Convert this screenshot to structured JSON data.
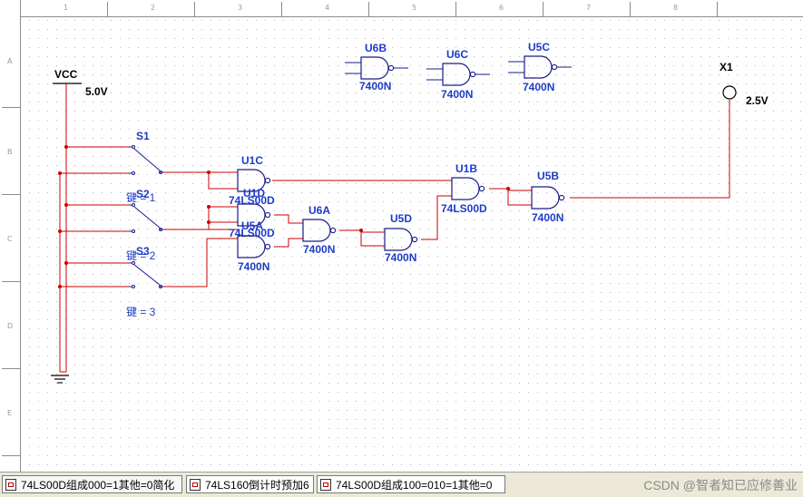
{
  "colors": {
    "wire": "#cc0000",
    "symbol": "#1a1a8c",
    "label": "#1e3cc8",
    "text": "#000000",
    "grid": "#b4b4b4"
  },
  "ruler": {
    "top": [
      "1",
      "2",
      "3",
      "4",
      "5",
      "6",
      "7",
      "8"
    ],
    "left": [
      "A",
      "B",
      "C",
      "D",
      "E"
    ]
  },
  "schematic": {
    "vcc": {
      "name": "VCC",
      "voltage": "5.0V"
    },
    "probe": {
      "name": "X1",
      "reading": "2.5V"
    },
    "switches": [
      {
        "name": "S1",
        "key_label": ""
      },
      {
        "name": "S2",
        "key_label": "键 = 1"
      },
      {
        "name": "S3",
        "key_label": "键 = 2"
      },
      {
        "name": "",
        "key_label": "键 = 3"
      }
    ],
    "gates": {
      "u6b": {
        "ref": "U6B",
        "type": "7400N"
      },
      "u6c": {
        "ref": "U6C",
        "type": "7400N"
      },
      "u5c": {
        "ref": "U5C",
        "type": "7400N"
      },
      "u1c": {
        "ref": "U1C",
        "type": ""
      },
      "u1d": {
        "ref": "U1D",
        "type": "74LS00D"
      },
      "u5a": {
        "ref": "U5A",
        "type": "74LS00D"
      },
      "u6a": {
        "ref": "U6A",
        "type": "7400N"
      },
      "g7400_left": {
        "ref": "",
        "type": "7400N"
      },
      "u5d": {
        "ref": "U5D",
        "type": "7400N"
      },
      "u1b": {
        "ref": "U1B",
        "type": "74LS00D"
      },
      "u5b": {
        "ref": "U5B",
        "type": "7400N"
      }
    }
  },
  "tabs": [
    {
      "label": "74LS00D组成000=1其他=0简化"
    },
    {
      "label": "74LS160倒计时预加6"
    },
    {
      "label": "74LS00D组成100=010=1其他=0"
    }
  ],
  "watermark": "CSDN @智者知已应修善业"
}
